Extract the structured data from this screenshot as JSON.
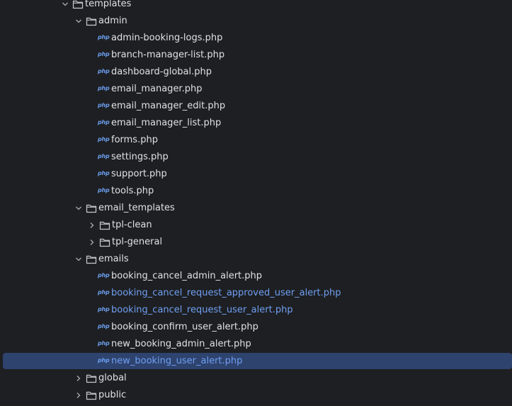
{
  "colors": {
    "background": "#1e1f22",
    "text": "#dfe1e5",
    "modified_text": "#6f9ff2",
    "selection": "#2e436e",
    "php_icon": "#6b9ff0"
  },
  "tree": [
    {
      "type": "folder",
      "label": "templates",
      "depth": 0,
      "expanded": true
    },
    {
      "type": "folder",
      "label": "admin",
      "depth": 1,
      "expanded": true
    },
    {
      "type": "file",
      "icon": "php",
      "label": "admin-booking-logs.php",
      "depth": 2
    },
    {
      "type": "file",
      "icon": "php",
      "label": "branch-manager-list.php",
      "depth": 2
    },
    {
      "type": "file",
      "icon": "php",
      "label": "dashboard-global.php",
      "depth": 2
    },
    {
      "type": "file",
      "icon": "php",
      "label": "email_manager.php",
      "depth": 2
    },
    {
      "type": "file",
      "icon": "php",
      "label": "email_manager_edit.php",
      "depth": 2
    },
    {
      "type": "file",
      "icon": "php",
      "label": "email_manager_list.php",
      "depth": 2
    },
    {
      "type": "file",
      "icon": "php",
      "label": "forms.php",
      "depth": 2
    },
    {
      "type": "file",
      "icon": "php",
      "label": "settings.php",
      "depth": 2
    },
    {
      "type": "file",
      "icon": "php",
      "label": "support.php",
      "depth": 2
    },
    {
      "type": "file",
      "icon": "php",
      "label": "tools.php",
      "depth": 2
    },
    {
      "type": "folder",
      "label": "email_templates",
      "depth": 1,
      "expanded": true
    },
    {
      "type": "folder",
      "label": "tpl-clean",
      "depth": 2,
      "expanded": false
    },
    {
      "type": "folder",
      "label": "tpl-general",
      "depth": 2,
      "expanded": false
    },
    {
      "type": "folder",
      "label": "emails",
      "depth": 1,
      "expanded": true
    },
    {
      "type": "file",
      "icon": "php",
      "label": "booking_cancel_admin_alert.php",
      "depth": 2
    },
    {
      "type": "file",
      "icon": "php",
      "label": "booking_cancel_request_approved_user_alert.php",
      "depth": 2,
      "modified": true
    },
    {
      "type": "file",
      "icon": "php",
      "label": "booking_cancel_request_user_alert.php",
      "depth": 2,
      "modified": true
    },
    {
      "type": "file",
      "icon": "php",
      "label": "booking_confirm_user_alert.php",
      "depth": 2
    },
    {
      "type": "file",
      "icon": "php",
      "label": "new_booking_admin_alert.php",
      "depth": 2
    },
    {
      "type": "file",
      "icon": "php",
      "label": "new_booking_user_alert.php",
      "depth": 2,
      "modified": true,
      "selected": true
    },
    {
      "type": "folder",
      "label": "global",
      "depth": 1,
      "expanded": false
    },
    {
      "type": "folder",
      "label": "public",
      "depth": 1,
      "expanded": false
    }
  ],
  "php_icon_text": "php"
}
